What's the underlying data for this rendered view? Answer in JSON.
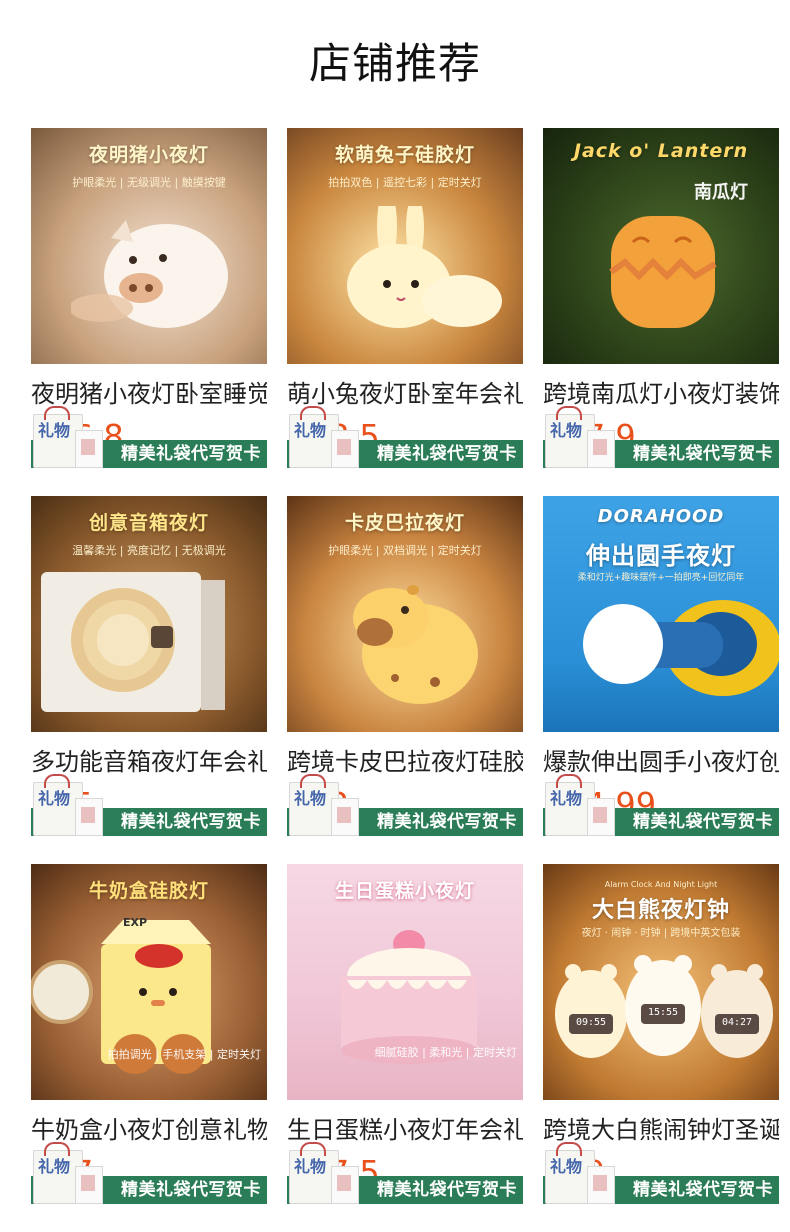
{
  "section": {
    "title": "店铺推荐"
  },
  "banner_text": "精美礼袋代写贺卡",
  "bag_mark": "礼物",
  "currency": "¥",
  "products": [
    {
      "name": "夜明猪小夜灯卧室睡觉",
      "price": "36.8",
      "image": {
        "headline": "夜明猪小夜灯",
        "tagline": "护眼柔光 | 无级调光 | 触摸按键",
        "subject": "pig-lamp"
      }
    },
    {
      "name": "萌小兔夜灯卧室年会礼",
      "price": "28.5",
      "image": {
        "headline": "软萌兔子硅胶灯",
        "tagline": "拍拍双色 | 遥控七彩 | 定时关灯",
        "subject": "rabbit-lamp"
      }
    },
    {
      "name": "跨境南瓜灯小夜灯装饰",
      "price": "27.9",
      "image": {
        "headline": "Jack o' Lantern",
        "tagline": "南瓜灯",
        "subject": "pumpkin-lamp"
      }
    },
    {
      "name": "多功能音箱夜灯年会礼",
      "price": "45",
      "image": {
        "headline": "创意音箱夜灯",
        "tagline": "温馨柔光 | 亮度记忆 | 无极调光",
        "subject": "speaker-lamp"
      }
    },
    {
      "name": "跨境卡皮巴拉夜灯硅胶",
      "price": "32",
      "image": {
        "headline": "卡皮巴拉夜灯",
        "tagline": "护眼柔光 | 双档调光 | 定时关灯",
        "subject": "capybara-lamp"
      }
    },
    {
      "name": "爆款伸出圆手小夜灯创",
      "price": "24.99",
      "image": {
        "headline": "伸出圆手夜灯",
        "brand": "DORAHOOD",
        "tagline": "柔和灯光+趣味摆件+一拍即亮+回忆同年",
        "subject": "hand-lamp"
      }
    },
    {
      "name": "牛奶盒小夜灯创意礼物",
      "price": "27",
      "image": {
        "headline": "牛奶盒硅胶灯",
        "tagline": "拍拍调光 | 手机支架 | 定时关灯",
        "box_label": "EXP",
        "subject": "milk-box-lamp"
      }
    },
    {
      "name": "生日蛋糕小夜灯年会礼",
      "price": "27.5",
      "image": {
        "headline": "生日蛋糕小夜灯",
        "tagline": "细腻硅胶 | 柔和光 | 定时关灯",
        "subject": "cake-lamp"
      }
    },
    {
      "name": "跨境大白熊闹钟灯圣诞",
      "price": "59",
      "image": {
        "headline": "大白熊夜灯钟",
        "eyebrow": "Alarm Clock And Night Light",
        "tagline": "夜灯 · 闹钟 · 时钟 | 跨境中英文包装",
        "clock_times": [
          "09:55",
          "15:55",
          "04:27"
        ],
        "subject": "bear-clock-lamp"
      }
    }
  ]
}
